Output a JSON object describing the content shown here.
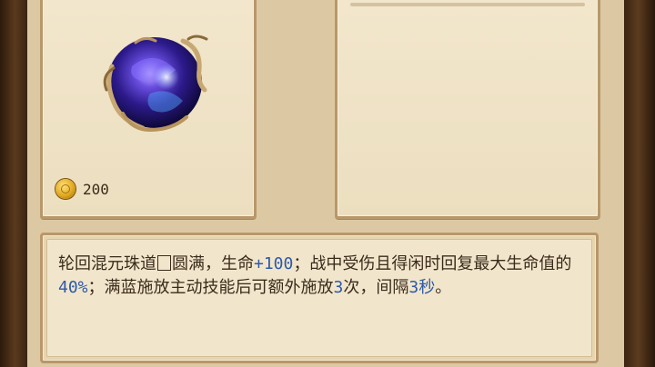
{
  "item": {
    "icon": "purple-orb-icon",
    "price": {
      "currency_icon": "gold-coin-icon",
      "value": "200"
    }
  },
  "description": {
    "segments": [
      {
        "text": "轮回混元珠道",
        "highlight": false
      },
      {
        "text": "圆满，生命",
        "highlight": false,
        "box_before": true
      },
      {
        "text": "+100",
        "highlight": true
      },
      {
        "text": "；战中受伤且得闲时回复最大生命值的",
        "highlight": false
      },
      {
        "text": "40%",
        "highlight": true
      },
      {
        "text": "；满蓝施放主动技能后可额外施放",
        "highlight": false
      },
      {
        "text": "3",
        "highlight": true
      },
      {
        "text": "次，间隔",
        "highlight": false
      },
      {
        "text": "3秒",
        "highlight": true
      },
      {
        "text": "。",
        "highlight": false
      }
    ]
  },
  "colors": {
    "highlight": "#2e5aa8",
    "text": "#3a2a1a",
    "parchment": "#f1e6cc",
    "border": "#b8976a"
  }
}
